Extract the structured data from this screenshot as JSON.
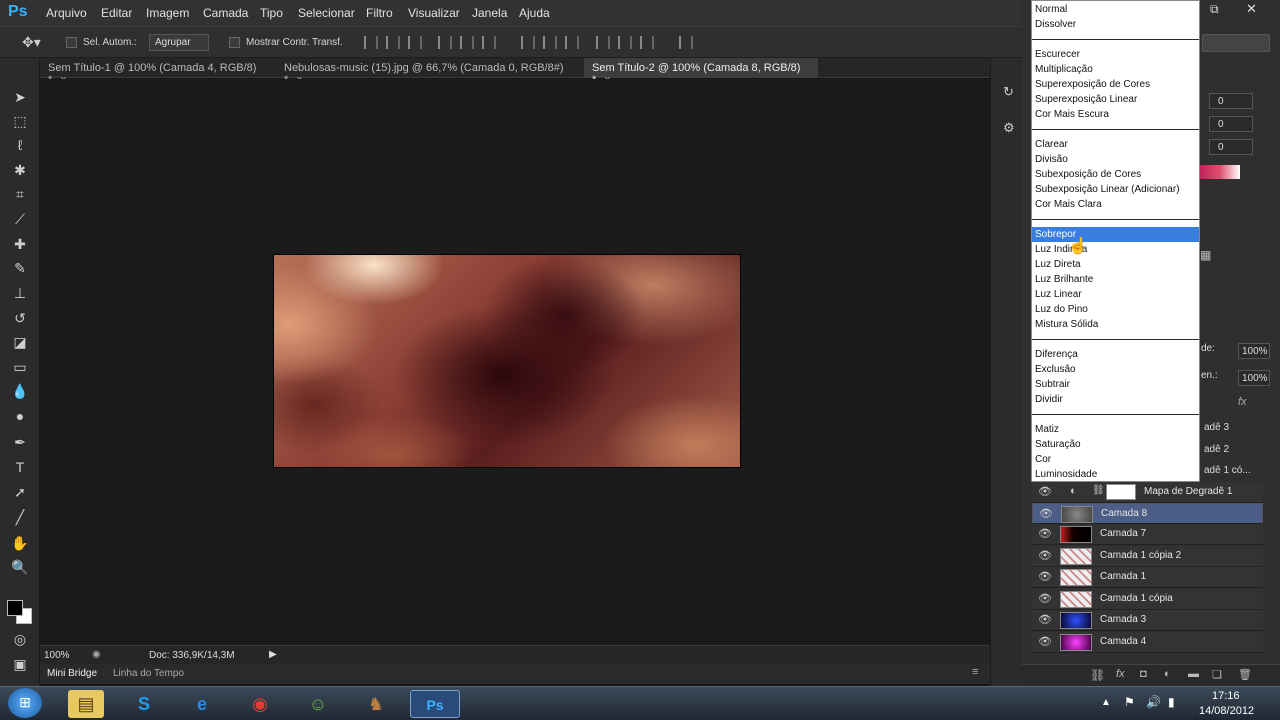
{
  "app": {
    "logo": "Ps"
  },
  "menu": [
    "Arquivo",
    "Editar",
    "Imagem",
    "Camada",
    "Tipo",
    "Selecionar",
    "Filtro",
    "Visualizar",
    "Janela",
    "Ajuda"
  ],
  "options": {
    "auto_select_label": "Sel. Autom.:",
    "group_value": "Agrupar",
    "show_transform_label": "Mostrar Contr. Transf."
  },
  "tabs": [
    {
      "label": "Sem Título-1 @ 100% (Camada 4, RGB/8) *"
    },
    {
      "label": "Nebulosas-music (15).jpg @ 66,7% (Camada 0, RGB/8#) *"
    },
    {
      "label": "Sem Título-2 @ 100% (Camada 8, RGB/8) *"
    }
  ],
  "tab_close": "×",
  "status": {
    "zoom": "100%",
    "doc": "Doc: 336,9K/14,3M"
  },
  "bottom_tabs": [
    "Mini Bridge",
    "Linha do Tempo"
  ],
  "blend_modes": [
    [
      "Normal",
      "Dissolver"
    ],
    [
      "Escurecer",
      "Multiplicação",
      "Superexposição de Cores",
      "Superexposição Linear",
      "Cor Mais Escura"
    ],
    [
      "Clarear",
      "Divisão",
      "Subexposição de Cores",
      "Subexposição Linear (Adicionar)",
      "Cor Mais Clara"
    ],
    [
      "Sobrepor",
      "Luz Indireta",
      "Luz Direta",
      "Luz Brilhante",
      "Luz Linear",
      "Luz do Pino",
      "Mistura Sólida"
    ],
    [
      "Diferença",
      "Exclusão",
      "Subtrair",
      "Dividir"
    ],
    [
      "Matiz",
      "Saturação",
      "Cor",
      "Luminosidade"
    ]
  ],
  "blend_selected": "Sobrepor",
  "color_values": [
    "0",
    "0",
    "0"
  ],
  "layers_panel": {
    "opacity_label": "de:",
    "opacity": "100%",
    "fill_label": "en.:",
    "fill": "100%",
    "partial_layers": [
      "adê 3",
      "adê 2",
      "adê 1 có..."
    ],
    "gradient_map": "Mapa de Degradê 1",
    "layers": [
      {
        "name": "Camada 8",
        "selected": true
      },
      {
        "name": "Camada 7"
      },
      {
        "name": "Camada 1 cópia 2"
      },
      {
        "name": "Camada 1"
      },
      {
        "name": "Camada 1 cópia"
      },
      {
        "name": "Camada 3"
      },
      {
        "name": "Camada 4"
      }
    ]
  },
  "taskbar": {
    "time": "17:16",
    "date": "14/08/2012"
  },
  "colors": {
    "accent": "#3a7de0",
    "selected_layer": "#4d5e86",
    "ps_blue": "#3ab1ff"
  }
}
